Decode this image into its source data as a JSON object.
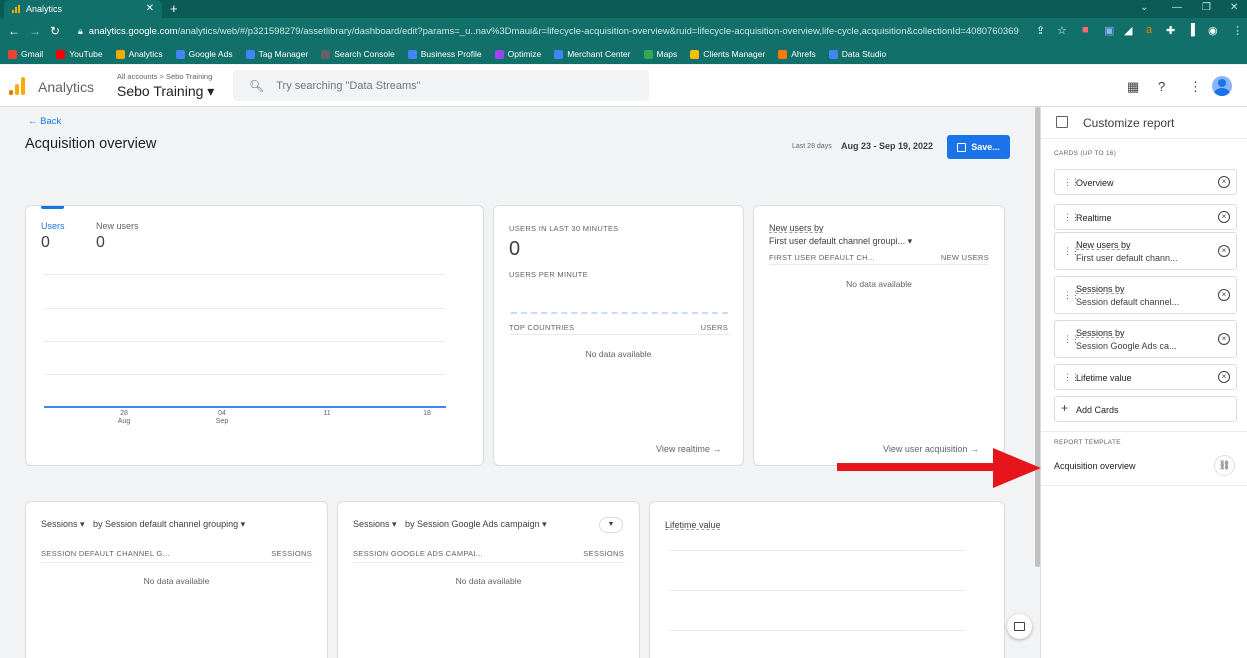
{
  "browser": {
    "tab_title": "Analytics",
    "tab_close": "✕",
    "new_tab": "+",
    "url_host": "analytics.google.com",
    "url_path": "/analytics/web/#/p321598279/assetlibrary/dashboard/edit?params=_u..nav%3Dmaui&r=lifecycle-acquisition-overview&ruid=lifecycle-acquisition-overview,life-cycle,acquisition&collectionId=4080760369",
    "bookmarks": [
      "Gmail",
      "YouTube",
      "Analytics",
      "Google Ads",
      "Tag Manager",
      "Search Console",
      "Business Profile",
      "Optimize",
      "Merchant Center",
      "Maps",
      "Clients Manager",
      "Ahrefs",
      "Data Studio"
    ],
    "bookmark_colors": [
      "#ea4335",
      "#ff0000",
      "#f9ab00",
      "#4285f4",
      "#4285f4",
      "#5f6368",
      "#4285f4",
      "#a142f4",
      "#4285f4",
      "#34a853",
      "#fbbc04",
      "#ff7a00",
      "#4285f4"
    ]
  },
  "header": {
    "app_name": "Analytics",
    "account_crumb": "All accounts > Sebo Training",
    "property_name": "Sebo Training ▾",
    "search_placeholder": "Try searching \"Data Streams\""
  },
  "page": {
    "back_label": "Back",
    "title": "Acquisition overview",
    "date_label": "Last 28 days",
    "date_range": "Aug 23 - Sep 19, 2022",
    "save_label": "Save..."
  },
  "users_card": {
    "tab_users": "Users",
    "users_value": "0",
    "tab_new_users": "New users",
    "new_users_value": "0",
    "x_ticks": [
      {
        "top": "28",
        "bottom": "Aug"
      },
      {
        "top": "04",
        "bottom": "Sep"
      },
      {
        "top": "11",
        "bottom": ""
      },
      {
        "top": "18",
        "bottom": ""
      }
    ]
  },
  "realtime_card": {
    "label": "USERS IN LAST 30 MINUTES",
    "value": "0",
    "per_minute": "USERS PER MINUTE",
    "col_countries": "TOP COUNTRIES",
    "col_users": "USERS",
    "no_data": "No data available",
    "link": "View realtime →"
  },
  "new_users_card": {
    "title": "New users by",
    "dimension": "First user default channel groupi... ▾",
    "col_left": "FIRST USER DEFAULT CH...",
    "col_right": "NEW USERS",
    "no_data": "No data available",
    "link": "View user acquisition →"
  },
  "sessions_channel_card": {
    "metric": "Sessions ▾",
    "dimension": "by Session default channel grouping ▾",
    "col_left": "SESSION DEFAULT CHANNEL G...",
    "col_right": "SESSIONS",
    "no_data": "No data available"
  },
  "sessions_ads_card": {
    "metric": "Sessions ▾",
    "dimension": "by Session Google Ads campaign ▾",
    "filter_icon": "▼",
    "col_left": "SESSION GOOGLE ADS CAMPAI...",
    "col_right": "SESSIONS",
    "no_data": "No data available"
  },
  "lifetime_card": {
    "title": "Lifetime value"
  },
  "panel": {
    "title": "Customize report",
    "cards_heading": "CARDS (UP TO 16)",
    "cards": [
      {
        "line1": "Overview",
        "line2": ""
      },
      {
        "line1": "Realtime",
        "line2": ""
      },
      {
        "line1": "New users by",
        "line2": "First user default chann..."
      },
      {
        "line1": "Sessions by",
        "line2": "Session default channel..."
      },
      {
        "line1": "Sessions by",
        "line2": "Session Google Ads ca..."
      },
      {
        "line1": "Lifetime value",
        "line2": ""
      }
    ],
    "remove_icon": "×",
    "add_cards": "Add Cards",
    "template_heading": "REPORT TEMPLATE",
    "template_name": "Acquisition overview"
  },
  "colors": {
    "accent": "#1a73e8",
    "annotation_arrow": "#e8141c",
    "chrome_bar": "#12706a"
  }
}
